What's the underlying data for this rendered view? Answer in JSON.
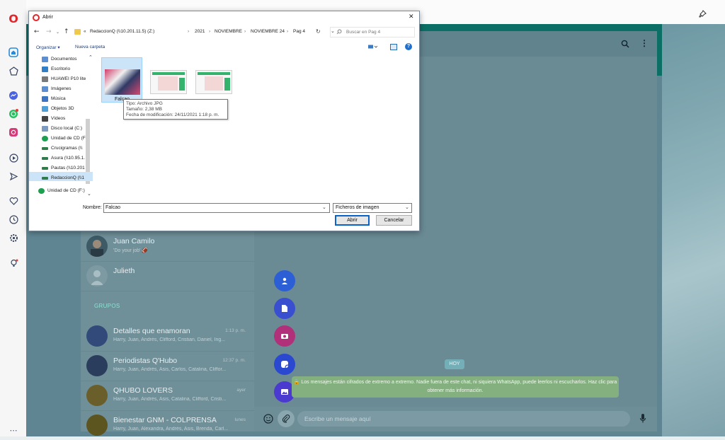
{
  "dialog": {
    "title": "Abrir",
    "close": "✕",
    "breadcrumb": [
      "RedaccionQ (\\\\10.201.11.5) (Z:)",
      "2021",
      "NOVIEMBRE",
      "NOVIEMBRE 24",
      "Pag 4"
    ],
    "breadcrumb_sep": "›",
    "breadcrumb_prefix": "«",
    "search_placeholder": "Buscar en Pag 4",
    "organize": "Organizar ▾",
    "new_folder": "Nueva carpeta",
    "nav_items": [
      {
        "label": "Documentos",
        "color": "#5b8fd1"
      },
      {
        "label": "Escritorio",
        "color": "#2f7fc9"
      },
      {
        "label": "HUAWEI P10 lite",
        "color": "#7a7a7a"
      },
      {
        "label": "Imágenes",
        "color": "#5b8fd1"
      },
      {
        "label": "Música",
        "color": "#3b75c4"
      },
      {
        "label": "Objetos 3D",
        "color": "#4da1d8"
      },
      {
        "label": "Vídeos",
        "color": "#444444"
      },
      {
        "label": "Disco local (C:)",
        "color": "#7b9cbf"
      },
      {
        "label": "Unidad de CD (F",
        "color": "#1e9e4f"
      },
      {
        "label": "Crucigramas (\\\\",
        "color": "#2f7d4a"
      },
      {
        "label": "Asura (\\\\10.95.1.",
        "color": "#2f7d4a"
      },
      {
        "label": "Pautas (\\\\10.201",
        "color": "#2f7d4a"
      },
      {
        "label": "RedaccionQ (\\\\1",
        "color": "#2f7d4a"
      }
    ],
    "nav_bottom": "Unidad de CD (F:)",
    "files": [
      {
        "name": "Falcao"
      },
      {
        "name": ""
      },
      {
        "name": ""
      }
    ],
    "tooltip": {
      "type": "Tipo: Archivo JPG",
      "size": "Tamaño: 2,38 MB",
      "date": "Fecha de modificación: 24/11/2021 1:18 p. m."
    },
    "filename_label": "Nombre:",
    "filename_value": "Falcao",
    "filter_value": "Ficheros de imagen",
    "open_button": "Abrir",
    "cancel_button": "Cancelar"
  },
  "whatsapp": {
    "chats": [
      {
        "name": "Juan Camilo",
        "last": "'Do your job' 🏈",
        "time": ""
      },
      {
        "name": "Julieth",
        "last": "",
        "time": ""
      }
    ],
    "groups_header": "GRUPOS",
    "groups": [
      {
        "name": "Detalles que enamoran",
        "time": "1:13 p. m.",
        "last": "Harry, Juan, Andrés, Clifford, Cristian, Daniel, Ing..."
      },
      {
        "name": "Periodistas Q'Hubo",
        "time": "12:37 p. m.",
        "last": "Harry, Juan, Andrés, Asis, Carlos, Catalina, Cliffor..."
      },
      {
        "name": "QHUBO LOVERS",
        "time": "ayer",
        "last": "Harry, Juan, Andrés, Asis, Catalina, Clifford, Cristi..."
      },
      {
        "name": "Bienestar GNM - COLPRENSA",
        "time": "lunes",
        "last": "Harry, Juan, Alexandra, Andrés, Asis, Brenda, Carl..."
      }
    ],
    "date_chip": "HOY",
    "encryption_notice": "🔒 Los mensajes están cifrados de extremo a extremo. Nadie fuera de este chat, ni siquiera WhatsApp, puede leerlos ni escucharlos. Haz clic para obtener más información.",
    "message_placeholder": "Escribe un mensaje aquí"
  },
  "colors": {
    "fab_contact": "#2c5fd6",
    "fab_document": "#3a4fd0",
    "fab_camera": "#b0307a",
    "fab_sticker": "#2a48d0",
    "fab_photo": "#4a3ad0"
  }
}
